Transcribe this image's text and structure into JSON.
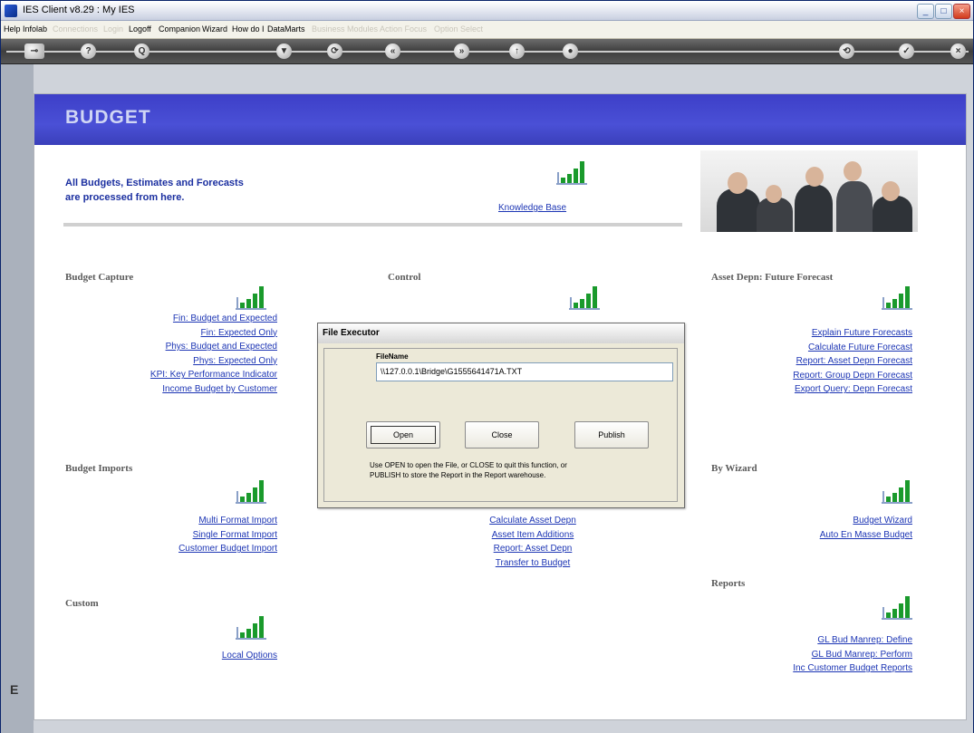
{
  "window": {
    "title": "IES Client v8.29 : My IES"
  },
  "menubar": {
    "items": [
      {
        "label": "Help",
        "dim": false
      },
      {
        "label": "Infolab",
        "dim": false
      },
      {
        "label": "Connections",
        "dim": true
      },
      {
        "label": "Login",
        "dim": true
      },
      {
        "label": "Logoff",
        "dim": false
      },
      {
        "label": "Companion",
        "dim": false
      },
      {
        "label": "Wizard",
        "dim": false
      },
      {
        "label": "How do I",
        "dim": false
      },
      {
        "label": "DataMarts",
        "dim": false
      },
      {
        "label": "Business Modules",
        "dim": true
      },
      {
        "label": "Action Focus",
        "dim": true
      },
      {
        "label": "Option Select",
        "dim": true
      }
    ]
  },
  "toolbar": {
    "buttons": [
      "?",
      "Q",
      "▼",
      "⟳",
      "«",
      "»",
      "↑",
      "●",
      "⟲",
      "✓",
      "×"
    ]
  },
  "panel": {
    "title": "BUDGET",
    "intro_line1": "All Budgets, Estimates and Forecasts",
    "intro_line2": "are processed from here.",
    "knowledge_base": "Knowledge Base"
  },
  "sections": {
    "budget_capture": {
      "title": "Budget Capture",
      "links": [
        "Fin: Budget and Expected",
        "Fin: Expected Only",
        "Phys: Budget and Expected",
        "Phys: Expected Only",
        "KPI: Key Performance Indicator",
        "Income Budget by Customer"
      ]
    },
    "control": {
      "title": "Control"
    },
    "asset_depn": {
      "title": "Asset Depn: Future Forecast",
      "links": [
        "Explain Future Forecasts",
        "Calculate Future Forecast",
        "Report: Asset Depn Forecast",
        "Report: Group Depn Forecast",
        "Export Query: Depn Forecast"
      ]
    },
    "budget_imports": {
      "title": "Budget Imports",
      "links": [
        "Multi Format Import",
        "Single Format Import",
        "Customer Budget Import"
      ]
    },
    "control_links": [
      "Calculate Asset Depn",
      "Asset Item Additions",
      "Report: Asset Depn",
      "Transfer to Budget"
    ],
    "by_wizard": {
      "title": "By Wizard",
      "links": [
        "Budget Wizard",
        "Auto En Masse Budget"
      ]
    },
    "custom": {
      "title": "Custom",
      "links": [
        "Local Options"
      ]
    },
    "reports": {
      "title": "Reports",
      "links": [
        "GL Bud Manrep: Define",
        "GL Bud Manrep: Perform",
        "Inc Customer Budget Reports"
      ]
    }
  },
  "dialog": {
    "title": "File Executor",
    "filename_label": "FileName",
    "filename_value": "\\\\127.0.0.1\\Bridge\\G1555641471A.TXT",
    "open_label": "Open",
    "close_label": "Close",
    "publish_label": "Publish",
    "message_line1": "Use OPEN to open the File, or CLOSE to quit this function, or",
    "message_line2": "PUBLISH to store the Report in the Report warehouse."
  },
  "side_letter": "E"
}
